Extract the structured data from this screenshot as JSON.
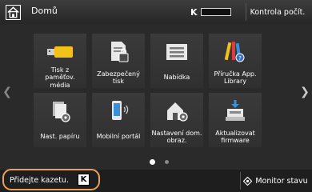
{
  "header": {
    "title": "Domů",
    "toner_letter": "K",
    "status_check_label": "Kontrola počít."
  },
  "tiles": [
    {
      "label": "Tisk z\npaměťov. média"
    },
    {
      "label": "Zabezpečený\ntisk"
    },
    {
      "label": "Nabídka"
    },
    {
      "label": "Příručka App.\nLibrary"
    },
    {
      "label": "Nast. papíru"
    },
    {
      "label": "Mobilní portál"
    },
    {
      "label": "Nastavení dom.\nobraz."
    },
    {
      "label": "Aktualizovat\nfirmware"
    }
  ],
  "footer": {
    "message": "Přidejte kazetu.",
    "message_cartridge": "K",
    "monitor_label": "Monitor stavu"
  },
  "colors": {
    "highlight": "#e6a15a",
    "usb_yellow": "#f2c21b",
    "mobile_blue": "#3a8fd8"
  },
  "icons": {
    "home": "home-icon",
    "left": "chevron-left-icon",
    "right": "chevron-right-icon",
    "monitor": "status-monitor-icon"
  }
}
